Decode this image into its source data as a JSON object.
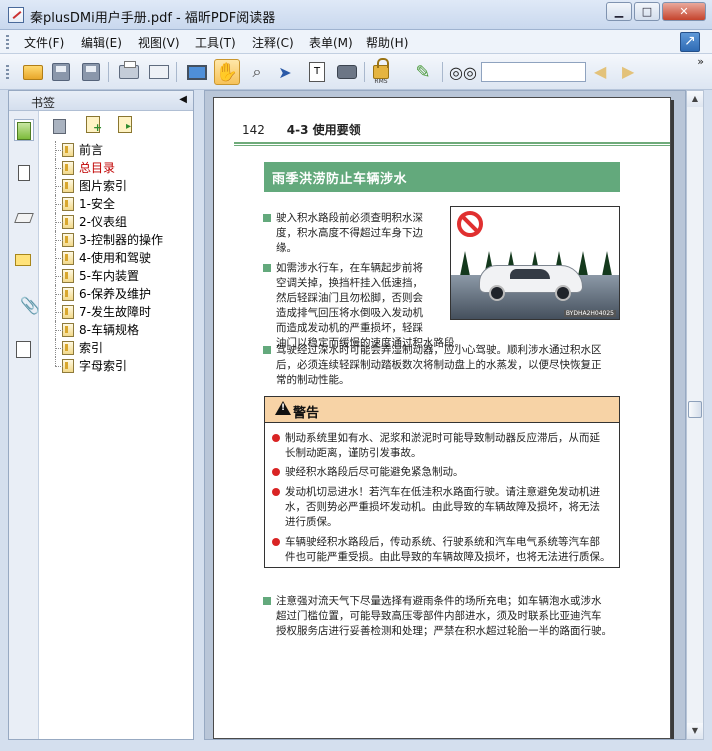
{
  "window": {
    "title": "秦plusDMi用户手册.pdf - 福昕PDF阅读器",
    "minimize": "▁",
    "maximize": "□",
    "close": "✕"
  },
  "menu": {
    "items": [
      "文件(F)",
      "编辑(E)",
      "视图(V)",
      "工具(T)",
      "注释(C)",
      "表单(M)",
      "帮助(H)"
    ]
  },
  "toolbar": {
    "icons": [
      "open-folder",
      "save",
      "save-as",
      "print",
      "scan",
      "full-screen",
      "hand-tool",
      "zoom-glass",
      "select-arrow",
      "text-select",
      "snapshot",
      "security-rms",
      "sign-check",
      "find-binoculars",
      "prev-result",
      "next-result"
    ],
    "rms_label": "RMS",
    "text_select_label": "T",
    "search_value": "",
    "prev_arrow": "◀",
    "next_arrow": "▶",
    "overflow": "»",
    "dropdown": "▼"
  },
  "bookmarks": {
    "title": "书签",
    "collapse_glyph": "◀",
    "items": [
      {
        "label": "前言",
        "highlight": false
      },
      {
        "label": "总目录",
        "highlight": true
      },
      {
        "label": "图片索引",
        "highlight": false
      },
      {
        "label": "1-安全",
        "highlight": false
      },
      {
        "label": "2-仪表组",
        "highlight": false
      },
      {
        "label": "3-控制器的操作",
        "highlight": false
      },
      {
        "label": "4-使用和驾驶",
        "highlight": false
      },
      {
        "label": "5-车内装置",
        "highlight": false
      },
      {
        "label": "6-保养及维护",
        "highlight": false
      },
      {
        "label": "7-发生故障时",
        "highlight": false
      },
      {
        "label": "8-车辆规格",
        "highlight": false
      },
      {
        "label": "索引",
        "highlight": false
      },
      {
        "label": "字母索引",
        "highlight": false
      }
    ]
  },
  "page": {
    "number": "142",
    "section": "4-3 使用要领",
    "heading": "雨季洪涝防止车辆涉水",
    "para1": [
      "驶入积水路段前必须查明积水深",
      "度，积水高度不得超过车身下边",
      "缘。"
    ],
    "para2": [
      "如需涉水行车，在车辆起步前将",
      "空调关掉，换挡杆挂入低速挡，",
      "然后轻踩油门且勿松脚，否则会",
      "造成排气回压将水倒吸入发动机",
      "而造成发动机的严重损坏，轻踩",
      "油门以稳定而缓慢的速度通过积水路段。"
    ],
    "para3": [
      "驾驶经过深水时可能会弄湿制动器，应小心驾驶。顺利涉水通过积水区",
      "后，必须连续轻踩制动踏板数次将制动盘上的水蒸发，以便尽快恢复正",
      "常的制动性能。"
    ],
    "image_code": "BYDHA2H04025",
    "warning": {
      "title": "警告",
      "items": [
        [
          "制动系统里如有水、泥浆和淤泥时可能导致制动器反应滞后，从而延",
          "长制动距离，谨防引发事故。"
        ],
        [
          "驶经积水路段后尽可能避免紧急制动。"
        ],
        [
          "发动机切忌进水！若汽车在低洼积水路面行驶。请注意避免发动机进",
          "水，否则势必严重损坏发动机。由此导致的车辆故障及损坏，将无法",
          "进行质保。"
        ],
        [
          "车辆驶经积水路段后，传动系统、行驶系统和汽车电气系统等汽车部",
          "件也可能严重受损。由此导致的车辆故障及损坏，也将无法进行质保。"
        ]
      ]
    },
    "para4": [
      "注意强对流天气下尽量选择有避雨条件的场所充电；如车辆泡水或涉水",
      "超过门槛位置，可能导致高压零部件内部进水，须及时联系比亚迪汽车",
      "授权服务店进行妥善检测和处理；严禁在积水超过轮胎一半的路面行驶。"
    ]
  },
  "scrollbar": {
    "up": "▲",
    "down": "▼",
    "position": 0.48
  }
}
